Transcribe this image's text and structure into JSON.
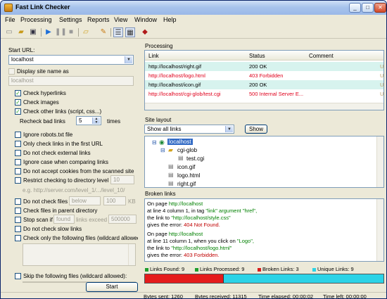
{
  "window": {
    "title": "Fast Link Checker"
  },
  "menu": [
    "File",
    "Processing",
    "Settings",
    "Reports",
    "View",
    "Window",
    "Help"
  ],
  "toolbar": {
    "icons": [
      "new-icon",
      "open-icon",
      "save-icon",
      "play-icon",
      "pause-icon",
      "stop-icon",
      "folder-icon",
      "pencil-icon",
      "list-view-icon",
      "grid-view-icon",
      "book-icon"
    ]
  },
  "left": {
    "start_url_label": "Start URL:",
    "start_url_value": "localhost",
    "display_site_name_label": "Display site name as",
    "display_site_name_value": "localhost",
    "check_hyperlinks": "Check hyperlinks",
    "check_images": "Check images",
    "check_other_links": "Check other links (script, css...)",
    "recheck_bad_links": "Recheck bad links",
    "recheck_value": "5",
    "times": "times",
    "ignore_robots": "Ignore robots.txt file",
    "only_first_url": "Only check links in the first URL",
    "no_external": "Do not check external links",
    "ignore_case": "Ignore case when comparing links",
    "no_cookies": "Do not accept cookies from the scanned site",
    "restrict_level": "Restrict checking to directory level",
    "restrict_value": "10",
    "restrict_hint": "e.g. http://server.com/level_1/.../level_10/",
    "no_check_files": "Do not check files",
    "below": "below",
    "kb_value": "100",
    "kb": "KB",
    "check_parent": "Check files in parent directory",
    "stop_scan": "Stop scan if",
    "found": "found",
    "links_exceed": "links exceed",
    "links_value": "500000",
    "no_slow": "Do not check slow links",
    "check_only": "Check only the following files (wildcard allowed):",
    "skip_files": "Skip the following files (wildcard allowed):",
    "start_button": "Start"
  },
  "processing": {
    "title": "Processing",
    "columns": [
      "Link",
      "Status",
      "Comment"
    ],
    "rows": [
      {
        "link": "http://localhost/right.gif",
        "status": "200 OK",
        "ok": true
      },
      {
        "link": "http://localhost/logo.html",
        "status": "403 Forbidden",
        "ok": false
      },
      {
        "link": "http://localhost/icon.gif",
        "status": "200 OK",
        "ok": true
      },
      {
        "link": "http://localhost/cgi-glob/test.cgi",
        "status": "500 Internal Server E...",
        "ok": false
      }
    ]
  },
  "site_layout": {
    "title": "Site layout",
    "filter": "Show all links",
    "show_button": "Show",
    "tree": [
      "localhost",
      "cgi-glob",
      "test.cgi",
      "icon.gif",
      "logo.html",
      "right.gif"
    ]
  },
  "broken": {
    "title": "Broken links",
    "e1": {
      "p1": "On page ",
      "page": "http://localhost",
      "l2a": "at line 4 column 1, in tag ",
      "tag": "\"link\" argument \"href\",",
      "l3a": "the link to ",
      "link": "\"http://localhost/style.css\"",
      "l4a": "gives the error: ",
      "err": "404 Not Found."
    },
    "e2": {
      "p1": "On page ",
      "page": "http://localhost",
      "l2a": "at line 11 column 1, when you click on ",
      "tag": "\"Logo\",",
      "l3a": "the link to ",
      "link": "\"http://localhost/logo.html\"",
      "l4a": "gives the error: ",
      "err": "403 Forbidden."
    }
  },
  "stats": {
    "links_found": "Links Found: 9",
    "links_processed": "Links Processed: 9",
    "broken_links": "Broken Links: 3",
    "unique_links": "Unique Links: 9",
    "broken_fraction": 0.33
  },
  "status": {
    "bytes_sent": "Bytes sent: 1260",
    "bytes_received": "Bytes received: 11315",
    "time_elapsed": "Time elapsed: 00:00:02",
    "time_left": "Time left: 00:00:00"
  },
  "colors": {
    "ok_row": "#d7f3ee",
    "error_text": "#e0001c",
    "green": "#008000",
    "progress_red": "#e51b1b",
    "progress_cyan": "#2cd3e6"
  }
}
